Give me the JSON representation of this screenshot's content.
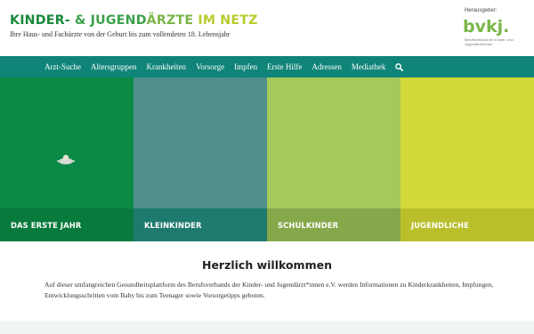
{
  "header": {
    "title_parts": [
      "KINDER- ",
      "& JUGEND",
      "ÄRZTE ",
      "IM NETZ"
    ],
    "subtitle": "Ihre Haus- und Fachärzte von der Geburt bis zum vollendeten 18. Lebensjahr",
    "publisher_label": "Herausgeber:",
    "publisher_logo_text": "bvkj.",
    "publisher_tagline": "Berufsverband der Kinder- und Jugendärzt*innen"
  },
  "nav": {
    "items": [
      "Arzt-Suche",
      "Altersgruppen",
      "Krankheiten",
      "Vorsorge",
      "Impfen",
      "Erste Hilfe",
      "Adressen",
      "Mediathek"
    ],
    "search_icon": "search-icon"
  },
  "tiles": [
    {
      "label": "DAS ERSTE JAHR",
      "color": "#0b8a46",
      "caption_color": "#087a3b"
    },
    {
      "label": "KLEINKINDER",
      "color": "#4f8f8c",
      "caption_color": "#1f7a6e"
    },
    {
      "label": "SCHULKINDER",
      "color": "#a6c95c",
      "caption_color": "#86a84a"
    },
    {
      "label": "JUGENDLICHE",
      "color": "#d4d93a",
      "caption_color": "#b8bf2a"
    }
  ],
  "welcome": {
    "title": "Herzlich willkommen",
    "text": "Auf dieser umfangreichen Gesundheitsplattform des Berufsverbands der Kinder- und Jugendärzt*innen e.V. werden Informationen zu Kinderkrankheiten, Impfungen, Entwicklungsschritten vom Baby bis zum Teenager sowie Vorsorgetipps geboten."
  },
  "colors": {
    "nav_bg": "#0f8478",
    "brand_green": "#1a8a3c",
    "brand_lime": "#b8cc2e"
  }
}
